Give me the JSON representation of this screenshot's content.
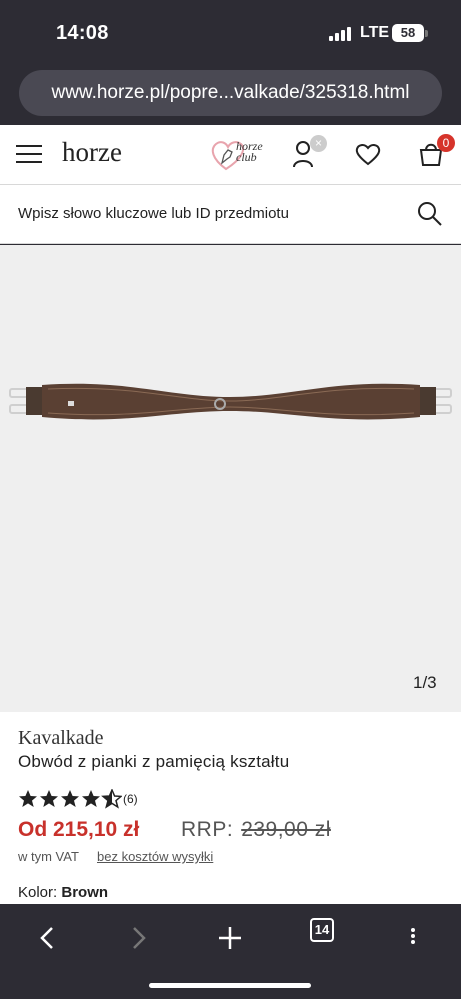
{
  "status": {
    "time": "14:08",
    "network": "LTE",
    "battery": "58"
  },
  "browser": {
    "url": "www.horze.pl/popre...valkade/325318.html",
    "tab_count": "14"
  },
  "header": {
    "logo": "horze",
    "club_line1": "horze",
    "club_line2": "club",
    "close_mark": "×",
    "cart_count": "0"
  },
  "search": {
    "placeholder": "Wpisz słowo kluczowe lub ID przedmiotu"
  },
  "gallery": {
    "pager": "1/3"
  },
  "product": {
    "brand": "Kavalkade",
    "title": "Obwód z pianki z pamięcią kształtu",
    "rating": 4.5,
    "rating_max": 5,
    "review_count": "(6)",
    "price": "Od 215,10 zł",
    "rrp_label": "RRP:",
    "rrp_value": "239,00 zł",
    "vat_note": "w tym VAT",
    "shipping_note": "bez kosztów wysyłki",
    "color_label": "Kolor:",
    "color_value": "Brown"
  },
  "colors": {
    "chrome": "#2d2c34",
    "price": "#c8312b",
    "badge": "#d6342b"
  }
}
